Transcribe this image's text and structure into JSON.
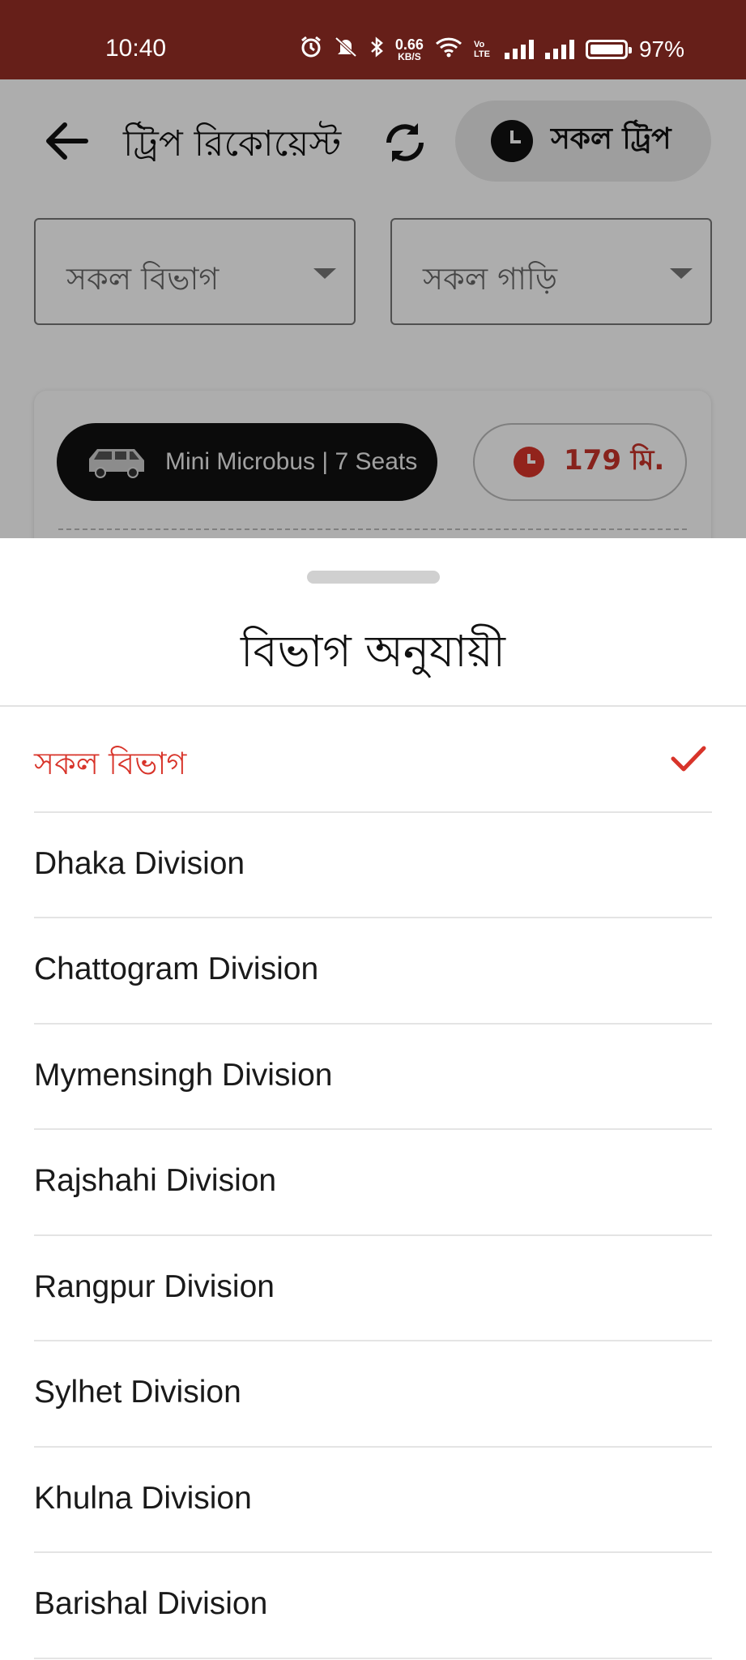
{
  "status_bar": {
    "time": "10:40",
    "net_speed_value": "0.66",
    "net_speed_unit": "KB/S",
    "volte": "Vo LTE",
    "battery": "97%"
  },
  "app_bar": {
    "title": "ট্রিপ রিকোয়েস্ট",
    "all_trips_label": "সকল ট্রিপ"
  },
  "filters": {
    "division": "সকল বিভাগ",
    "vehicle": "সকল গাড়ি"
  },
  "trip_card": {
    "vehicle": "Mini Microbus | 7 Seats",
    "time": "179 মি."
  },
  "sheet": {
    "title": "বিভাগ অনুযায়ী",
    "items": [
      {
        "label": "সকল বিভাগ",
        "selected": true
      },
      {
        "label": "Dhaka Division"
      },
      {
        "label": "Chattogram Division"
      },
      {
        "label": "Mymensingh Division"
      },
      {
        "label": "Rajshahi Division"
      },
      {
        "label": "Rangpur Division"
      },
      {
        "label": "Sylhet Division"
      },
      {
        "label": "Khulna Division"
      },
      {
        "label": "Barishal Division"
      }
    ]
  },
  "colors": {
    "status_bar_bg": "#661f19",
    "accent": "#d8342a",
    "pill_dark": "#111111"
  },
  "icons": [
    "alarm-icon",
    "mute-icon",
    "bluetooth-icon",
    "wifi-icon",
    "signal-icon",
    "battery-icon",
    "back-arrow-icon",
    "refresh-icon",
    "clock-icon",
    "van-icon",
    "checkmark-icon"
  ]
}
